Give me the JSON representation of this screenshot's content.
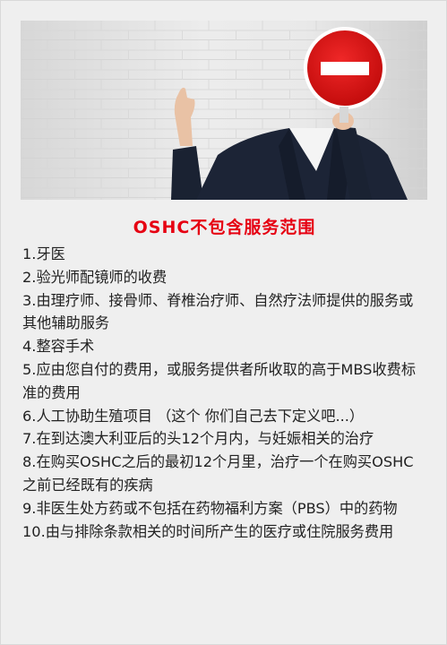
{
  "title": "OSHC不包含服务范围",
  "items": [
    "1.牙医",
    "2.验光师配镜师的收费",
    "3.由理疗师、接骨师、脊椎治疗师、自然疗法师提供的服务或其他辅助服务",
    "4.整容手术",
    "5.应由您自付的费用，或服务提供者所收取的高于MBS收费标准的费用",
    "6.人工协助生殖项目 （这个 你们自己去下定义吧...）",
    "7.在到达澳大利亚后的头12个月内，与妊娠相关的治疗",
    "8.在购买OSHC之后的最初12个月里，治疗一个在购买OSHC之前已经既有的疾病",
    "9.非医生处方药或不包括在药物福利方案（PBS）中的药物",
    "10.由与排除条款相关的时间所产生的医疗或住院服务费用"
  ]
}
